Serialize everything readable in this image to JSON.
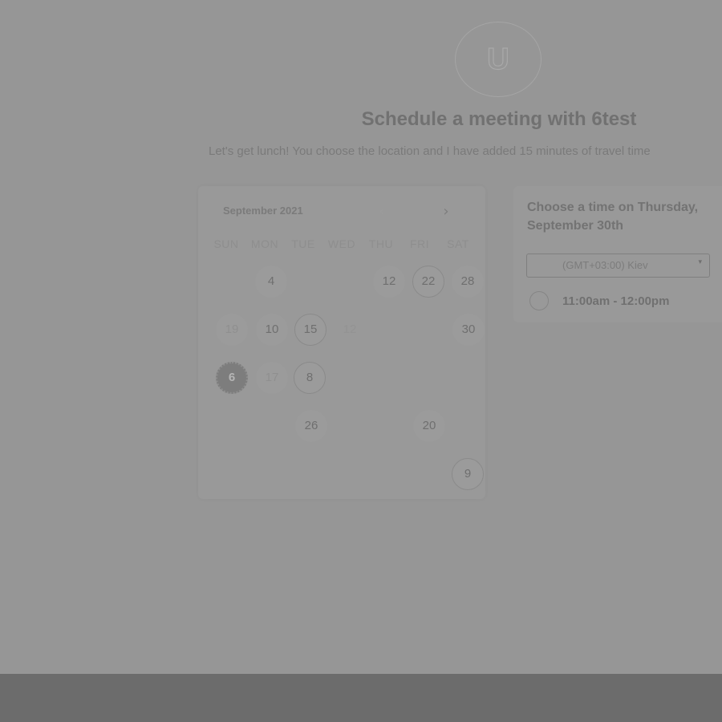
{
  "avatar": {
    "letter": "U"
  },
  "header": {
    "title": "Schedule a meeting with 6test",
    "subtitle": "Let's get lunch! You choose the location and I have added 15 minutes of travel time"
  },
  "calendar": {
    "month_label": "September 2021",
    "prev_icon": "chevron-left-icon",
    "next_icon": "chevron-right-icon",
    "prev_glyph": "‹",
    "next_glyph": "›",
    "weekdays": [
      "SUN",
      "MON",
      "TUE",
      "WED",
      "THU",
      "FRI",
      "SAT"
    ],
    "rows": [
      [
        "",
        "4",
        "",
        "",
        "12",
        "22",
        "28"
      ],
      [
        "19",
        "10",
        "15",
        "12",
        "",
        "",
        "30"
      ],
      [
        "6",
        "17",
        "8",
        "",
        "",
        "",
        ""
      ],
      [
        "",
        "",
        "26",
        "",
        "",
        "20",
        ""
      ],
      [
        "",
        "",
        "",
        "",
        "",
        "",
        "9"
      ]
    ],
    "selected_day": "6"
  },
  "time_panel": {
    "header": "Choose a time on Thursday, September 30th",
    "timezone": "(GMT+03:00) Kiev",
    "caret": "▾",
    "slots": [
      {
        "label": "11:00am - 12:00pm"
      }
    ]
  }
}
